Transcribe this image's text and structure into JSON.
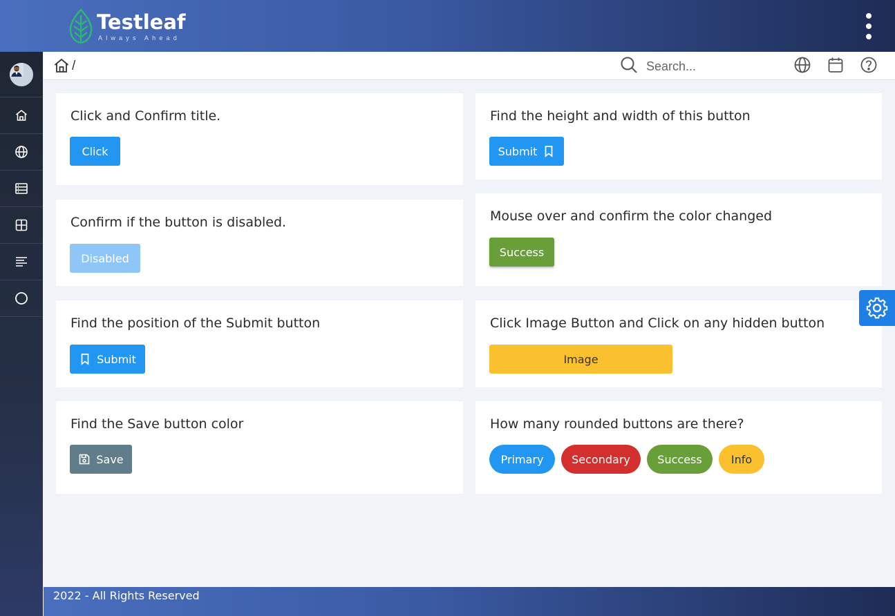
{
  "brand": {
    "name": "Testleaf",
    "tagline": "Always Ahead",
    "leaf_color": "#2bb673"
  },
  "header": {
    "menu_icon": "kebab-menu-icon"
  },
  "sidebar": {
    "items": [
      {
        "name": "user-avatar"
      },
      {
        "icon": "home-icon"
      },
      {
        "icon": "globe-icon"
      },
      {
        "icon": "server-icon"
      },
      {
        "icon": "grid-icon"
      },
      {
        "icon": "align-left-icon"
      },
      {
        "icon": "circle-icon"
      }
    ]
  },
  "breadcrumb": {
    "home_icon": "home-icon",
    "separator": "/"
  },
  "search": {
    "placeholder": "Search..."
  },
  "header_actions": [
    "globe-icon",
    "calendar-icon",
    "help-icon"
  ],
  "cards": {
    "click_confirm": {
      "title": "Click and Confirm title.",
      "button": "Click"
    },
    "height_width": {
      "title": "Find the height and width of this button",
      "button": "Submit"
    },
    "disabled": {
      "title": "Confirm if the button is disabled.",
      "button": "Disabled"
    },
    "mouse_over": {
      "title": "Mouse over and confirm the color changed",
      "button": "Success"
    },
    "position": {
      "title": "Find the position of the Submit button",
      "button": "Submit"
    },
    "image": {
      "title": "Click Image Button and Click on any hidden button",
      "button": "Image"
    },
    "save_color": {
      "title": "Find the Save button color",
      "button": "Save"
    },
    "rounded": {
      "title": "How many rounded buttons are there?",
      "buttons": [
        "Primary",
        "Secondary",
        "Success",
        "Info"
      ]
    }
  },
  "colors": {
    "primary": "#2196f3",
    "disabled": "#8ec6f8",
    "success": "#689f38",
    "warning": "#fbc02d",
    "secondary_gray": "#607d8b",
    "danger": "#d32f2f",
    "config_button": "#1e80e6"
  },
  "config_button": {
    "icon": "gear-icon"
  },
  "footer": {
    "text": "2022 - All Rights Reserved"
  }
}
